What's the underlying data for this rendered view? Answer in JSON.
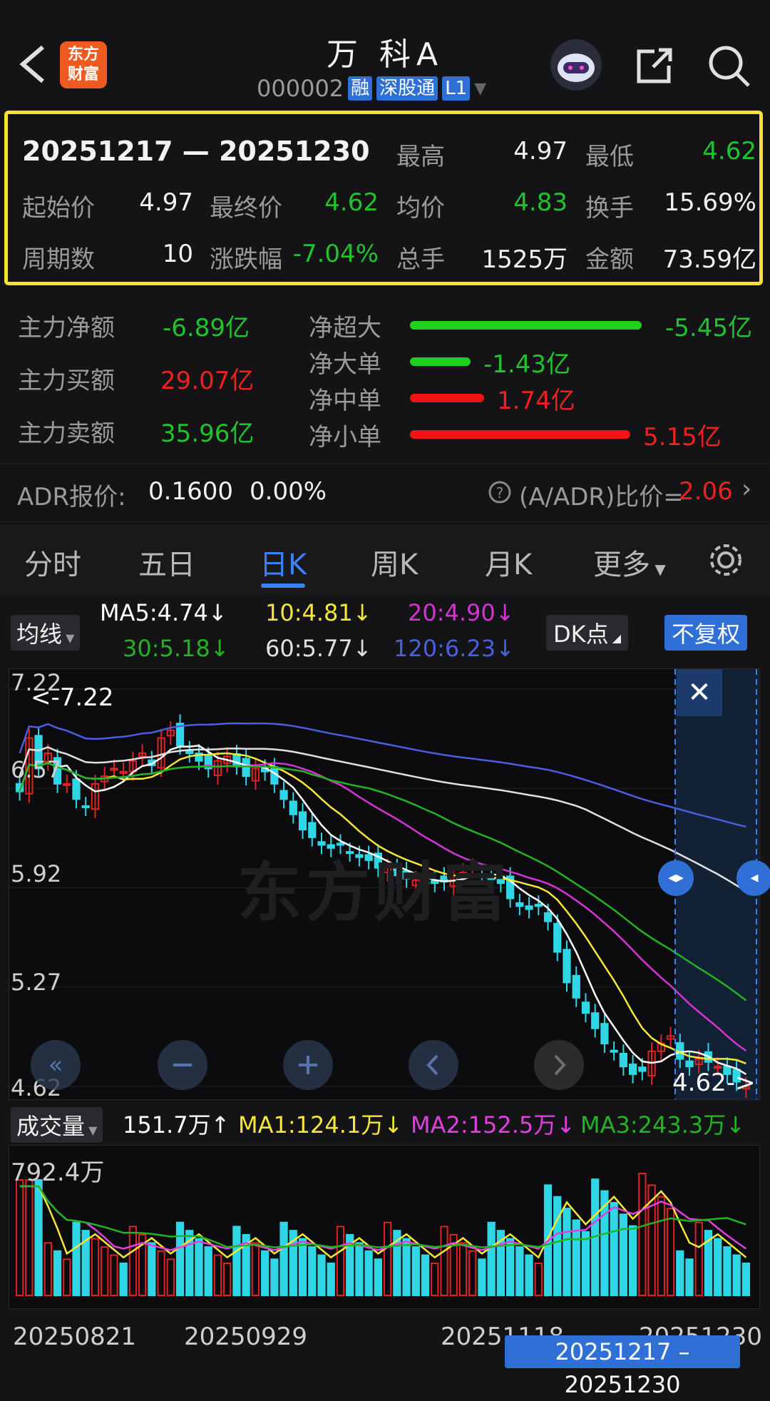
{
  "header": {
    "title": "万 科A",
    "code": "000002",
    "tags": [
      "融",
      "深股通",
      "L1"
    ],
    "logo_text": [
      "东方",
      "财富"
    ]
  },
  "summary": {
    "range": "20251217 — 20251230",
    "high_label": "最高",
    "high": "4.97",
    "low_label": "最低",
    "low": "4.62",
    "open_label": "起始价",
    "open": "4.97",
    "close_label": "最终价",
    "close": "4.62",
    "avg_label": "均价",
    "avg": "4.83",
    "turnover_label": "换手",
    "turnover": "15.69%",
    "periods_label": "周期数",
    "periods": "10",
    "change_label": "涨跌幅",
    "change": "-7.04%",
    "volume_label": "总手",
    "volume": "1525万",
    "amount_label": "金额",
    "amount": "73.59亿"
  },
  "capital_flow": {
    "net_main_label": "主力净额",
    "net_main": "-6.89亿",
    "buy_main_label": "主力买额",
    "buy_main": "29.07亿",
    "sell_main_label": "主力卖额",
    "sell_main": "35.96亿",
    "rows": [
      {
        "label": "净超大",
        "value": "-5.45亿",
        "color": "#1fd11f",
        "ratio": 1.0
      },
      {
        "label": "净大单",
        "value": "-1.43亿",
        "color": "#1fd11f",
        "ratio": 0.26
      },
      {
        "label": "净中单",
        "value": "1.74亿",
        "color": "#f01414",
        "ratio": 0.32
      },
      {
        "label": "净小单",
        "value": "5.15亿",
        "color": "#f01414",
        "ratio": 0.95
      }
    ]
  },
  "adr": {
    "label": "ADR报价:",
    "price": "0.1600",
    "pct": "0.00%",
    "ratio_label": "(A/ADR)比价=",
    "ratio": "2.06"
  },
  "tabs": [
    "分时",
    "五日",
    "日K",
    "周K",
    "月K",
    "更多"
  ],
  "active_tab": "日K",
  "ma": {
    "selector": "均线",
    "ma5": "MA5:4.74↓",
    "ma10": "10:4.81↓",
    "ma20": "20:4.90↓",
    "ma30": "30:5.18↓",
    "ma60": "60:5.77↓",
    "ma120": "120:6.23↓",
    "dk": "DK点",
    "fq": "不复权",
    "colors": {
      "ma5": "#ffffff",
      "ma10": "#f5e63a",
      "ma20": "#d633d6",
      "ma30": "#22b322",
      "ma60": "#e0e0e0",
      "ma120": "#4a5fe0"
    }
  },
  "kchart": {
    "y_ticks": [
      "7.22",
      "6.57",
      "5.92",
      "5.27",
      "4.62"
    ],
    "max_label": "<-7.22",
    "min_label": "4.62->",
    "watermark": "东方财富",
    "close_btn": "✕"
  },
  "volume": {
    "selector": "成交量",
    "vol": "151.7万↑",
    "ma1": "MA1:124.1万↓",
    "ma2": "MA2:152.5万↓",
    "ma3": "MA3:243.3万↓",
    "max_label": "792.4万",
    "x_labels": [
      "20250821",
      "20250929",
      "20251118",
      "20251230"
    ],
    "range_badge": "20251217 – 20251230"
  },
  "chart_data": {
    "type": "candlestick",
    "ylim": [
      4.62,
      7.22
    ],
    "series": [
      {
        "name": "MA5",
        "value": 4.74
      },
      {
        "name": "MA10",
        "value": 4.81
      },
      {
        "name": "MA20",
        "value": 4.9
      },
      {
        "name": "MA30",
        "value": 5.18
      },
      {
        "name": "MA60",
        "value": 5.77
      },
      {
        "name": "MA120",
        "value": 6.23
      }
    ],
    "closes": [
      6.55,
      6.9,
      6.7,
      6.8,
      6.6,
      6.6,
      6.5,
      6.45,
      6.6,
      6.65,
      6.7,
      6.68,
      6.75,
      6.8,
      6.72,
      6.9,
      6.95,
      6.85,
      6.8,
      6.75,
      6.7,
      6.75,
      6.78,
      6.72,
      6.65,
      6.7,
      6.68,
      6.6,
      6.5,
      6.4,
      6.3,
      6.25,
      6.2,
      6.18,
      6.2,
      6.15,
      6.12,
      6.1,
      6.05,
      6.05,
      6.0,
      5.98,
      5.97,
      5.95,
      5.95,
      5.96,
      6.0,
      6.02,
      6.05,
      6.0,
      5.98,
      5.95,
      5.85,
      5.8,
      5.78,
      5.8,
      5.7,
      5.5,
      5.3,
      5.2,
      5.1,
      5.0,
      4.9,
      4.85,
      4.75,
      4.7,
      4.72,
      4.85,
      4.9,
      4.95,
      4.8,
      4.75,
      4.8,
      4.78,
      4.75,
      4.7,
      4.65,
      4.62
    ]
  }
}
